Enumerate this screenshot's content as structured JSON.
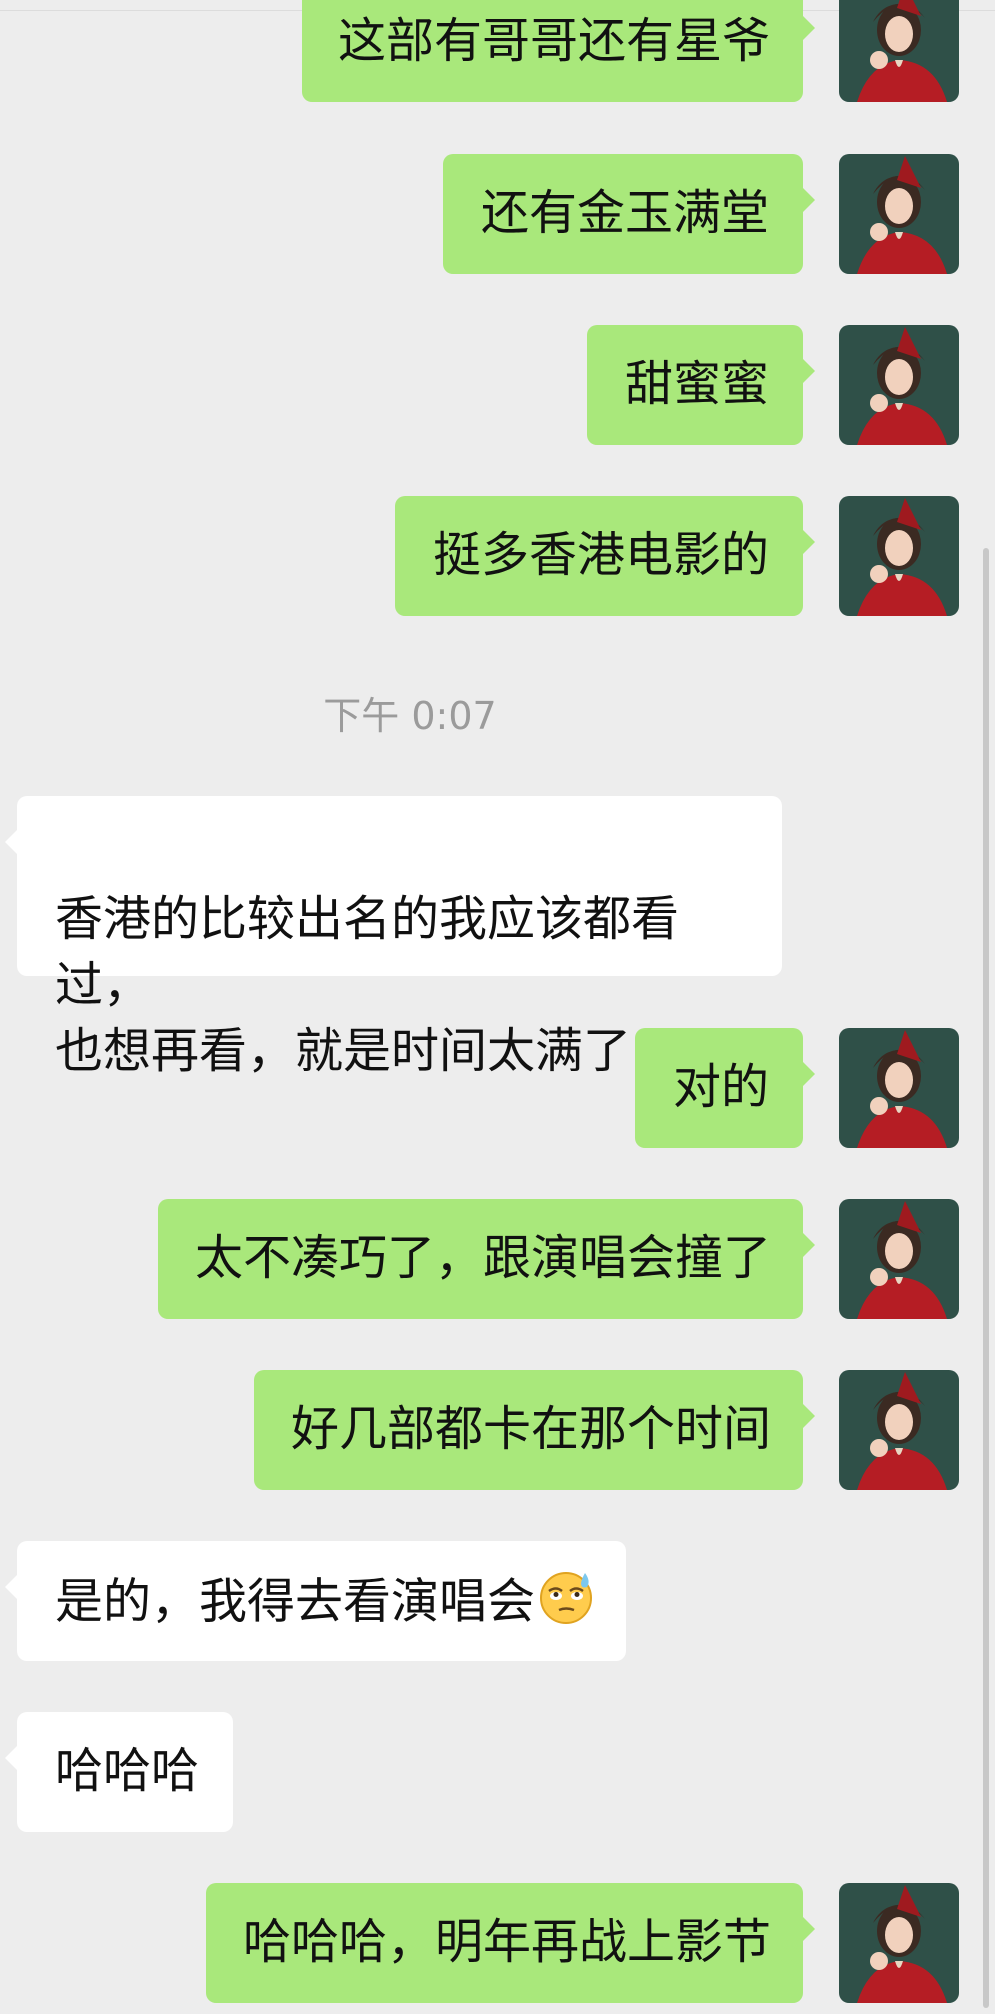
{
  "messages": [
    {
      "side": "sent",
      "text": "这部有哥哥还有星爷"
    },
    {
      "side": "sent",
      "text": "还有金玉满堂"
    },
    {
      "side": "sent",
      "text": "甜蜜蜜"
    },
    {
      "side": "sent",
      "text": "挺多香港电影的"
    },
    {
      "side": "time",
      "text": "下午 0:07"
    },
    {
      "side": "received",
      "text": "香港的比较出名的我应该都看过，\n也想再看，就是时间太满了"
    },
    {
      "side": "sent",
      "text": "对的"
    },
    {
      "side": "sent",
      "text": "太不凑巧了，跟演唱会撞了"
    },
    {
      "side": "sent",
      "text": "好几部都卡在那个时间"
    },
    {
      "side": "received",
      "text": "是的，我得去看演唱会",
      "emoji": "eye-roll-sweat-emoji"
    },
    {
      "side": "received",
      "text": "哈哈哈"
    },
    {
      "side": "sent",
      "text": "哈哈哈，明年再战上影节"
    }
  ],
  "colors": {
    "background": "#ededed",
    "sent_bubble": "#a9e87b",
    "received_bubble": "#ffffff",
    "timestamp": "#9b9b9b"
  }
}
